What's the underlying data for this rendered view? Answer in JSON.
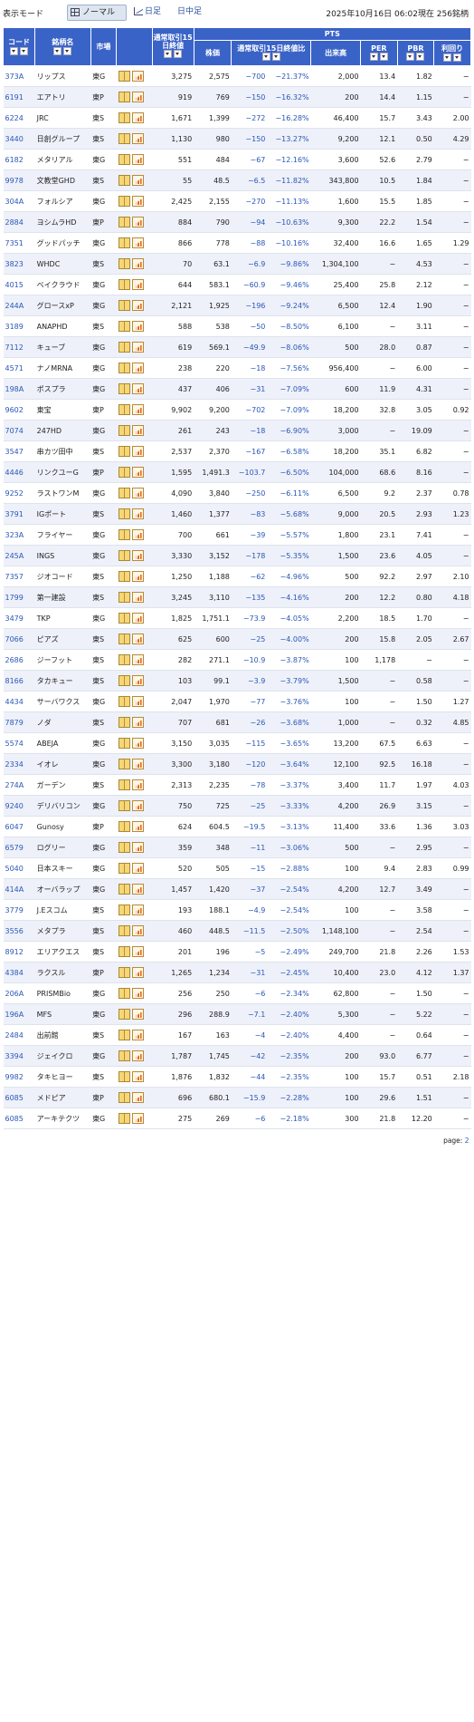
{
  "toolbar": {
    "mode_label": "表示モード",
    "normal": "ノーマル",
    "daily": "日足",
    "intraday": "日中足",
    "timestamp": "2025年10月16日  06:02現在  256銘柄"
  },
  "headers": {
    "code": "コード",
    "name": "銘柄名",
    "market": "市場",
    "prev_close": "通常取引15日終値",
    "pts": "PTS",
    "price": "株価",
    "change": "通常取引15日終値比",
    "volume": "出来高",
    "per": "PER",
    "pbr": "PBR",
    "yield": "利回り"
  },
  "rows": [
    [
      "373A",
      "リップス",
      "東G",
      "3,275",
      "2,575",
      "−700",
      "−21.37%",
      "2,000",
      "13.4",
      "1.82",
      "−"
    ],
    [
      "6191",
      "エアトリ",
      "東P",
      "919",
      "769",
      "−150",
      "−16.32%",
      "200",
      "14.4",
      "1.15",
      "−"
    ],
    [
      "6224",
      "JRC",
      "東S",
      "1,671",
      "1,399",
      "−272",
      "−16.28%",
      "46,400",
      "15.7",
      "3.43",
      "2.00"
    ],
    [
      "3440",
      "日創グループ",
      "東S",
      "1,130",
      "980",
      "−150",
      "−13.27%",
      "9,200",
      "12.1",
      "0.50",
      "4.29"
    ],
    [
      "6182",
      "メタリアル",
      "東G",
      "551",
      "484",
      "−67",
      "−12.16%",
      "3,600",
      "52.6",
      "2.79",
      "−"
    ],
    [
      "9978",
      "文教堂GHD",
      "東S",
      "55",
      "48.5",
      "−6.5",
      "−11.82%",
      "343,800",
      "10.5",
      "1.84",
      "−"
    ],
    [
      "304A",
      "フォルシア",
      "東G",
      "2,425",
      "2,155",
      "−270",
      "−11.13%",
      "1,600",
      "15.5",
      "1.85",
      "−"
    ],
    [
      "2884",
      "ヨシムラHD",
      "東P",
      "884",
      "790",
      "−94",
      "−10.63%",
      "9,300",
      "22.2",
      "1.54",
      "−"
    ],
    [
      "7351",
      "グッドパッチ",
      "東G",
      "866",
      "778",
      "−88",
      "−10.16%",
      "32,400",
      "16.6",
      "1.65",
      "1.29"
    ],
    [
      "3823",
      "WHDC",
      "東S",
      "70",
      "63.1",
      "−6.9",
      "−9.86%",
      "1,304,100",
      "−",
      "4.53",
      "−"
    ],
    [
      "4015",
      "ベイクラウド",
      "東G",
      "644",
      "583.1",
      "−60.9",
      "−9.46%",
      "25,400",
      "25.8",
      "2.12",
      "−"
    ],
    [
      "244A",
      "グロースxP",
      "東G",
      "2,121",
      "1,925",
      "−196",
      "−9.24%",
      "6,500",
      "12.4",
      "1.90",
      "−"
    ],
    [
      "3189",
      "ANAPHD",
      "東S",
      "588",
      "538",
      "−50",
      "−8.50%",
      "6,100",
      "−",
      "3.11",
      "−"
    ],
    [
      "7112",
      "キューブ",
      "東G",
      "619",
      "569.1",
      "−49.9",
      "−8.06%",
      "500",
      "28.0",
      "0.87",
      "−"
    ],
    [
      "4571",
      "ナノMRNA",
      "東G",
      "238",
      "220",
      "−18",
      "−7.56%",
      "956,400",
      "−",
      "6.00",
      "−"
    ],
    [
      "198A",
      "ポスプラ",
      "東G",
      "437",
      "406",
      "−31",
      "−7.09%",
      "600",
      "11.9",
      "4.31",
      "−"
    ],
    [
      "9602",
      "東宝",
      "東P",
      "9,902",
      "9,200",
      "−702",
      "−7.09%",
      "18,200",
      "32.8",
      "3.05",
      "0.92"
    ],
    [
      "7074",
      "247HD",
      "東G",
      "261",
      "243",
      "−18",
      "−6.90%",
      "3,000",
      "−",
      "19.09",
      "−"
    ],
    [
      "3547",
      "串カツ田中",
      "東S",
      "2,537",
      "2,370",
      "−167",
      "−6.58%",
      "18,200",
      "35.1",
      "6.82",
      "−"
    ],
    [
      "4446",
      "リンクユーG",
      "東P",
      "1,595",
      "1,491.3",
      "−103.7",
      "−6.50%",
      "104,000",
      "68.6",
      "8.16",
      "−"
    ],
    [
      "9252",
      "ラストワンM",
      "東G",
      "4,090",
      "3,840",
      "−250",
      "−6.11%",
      "6,500",
      "9.2",
      "2.37",
      "0.78"
    ],
    [
      "3791",
      "IGポート",
      "東S",
      "1,460",
      "1,377",
      "−83",
      "−5.68%",
      "9,000",
      "20.5",
      "2.93",
      "1.23"
    ],
    [
      "323A",
      "フライヤー",
      "東G",
      "700",
      "661",
      "−39",
      "−5.57%",
      "1,800",
      "23.1",
      "7.41",
      "−"
    ],
    [
      "245A",
      "INGS",
      "東G",
      "3,330",
      "3,152",
      "−178",
      "−5.35%",
      "1,500",
      "23.6",
      "4.05",
      "−"
    ],
    [
      "7357",
      "ジオコード",
      "東S",
      "1,250",
      "1,188",
      "−62",
      "−4.96%",
      "500",
      "92.2",
      "2.97",
      "2.10"
    ],
    [
      "1799",
      "第一建設",
      "東S",
      "3,245",
      "3,110",
      "−135",
      "−4.16%",
      "200",
      "12.2",
      "0.80",
      "4.18"
    ],
    [
      "3479",
      "TKP",
      "東G",
      "1,825",
      "1,751.1",
      "−73.9",
      "−4.05%",
      "2,200",
      "18.5",
      "1.70",
      "−"
    ],
    [
      "7066",
      "ピアズ",
      "東S",
      "625",
      "600",
      "−25",
      "−4.00%",
      "200",
      "15.8",
      "2.05",
      "2.67"
    ],
    [
      "2686",
      "ジーフット",
      "東S",
      "282",
      "271.1",
      "−10.9",
      "−3.87%",
      "100",
      "1,178",
      "−",
      "−"
    ],
    [
      "8166",
      "タカキュー",
      "東S",
      "103",
      "99.1",
      "−3.9",
      "−3.79%",
      "1,500",
      "−",
      "0.58",
      "−"
    ],
    [
      "4434",
      "サーバワクス",
      "東G",
      "2,047",
      "1,970",
      "−77",
      "−3.76%",
      "100",
      "−",
      "1.50",
      "1.27"
    ],
    [
      "7879",
      "ノダ",
      "東S",
      "707",
      "681",
      "−26",
      "−3.68%",
      "1,000",
      "−",
      "0.32",
      "4.85"
    ],
    [
      "5574",
      "ABEJA",
      "東G",
      "3,150",
      "3,035",
      "−115",
      "−3.65%",
      "13,200",
      "67.5",
      "6.63",
      "−"
    ],
    [
      "2334",
      "イオレ",
      "東G",
      "3,300",
      "3,180",
      "−120",
      "−3.64%",
      "12,100",
      "92.5",
      "16.18",
      "−"
    ],
    [
      "274A",
      "ガーデン",
      "東S",
      "2,313",
      "2,235",
      "−78",
      "−3.37%",
      "3,400",
      "11.7",
      "1.97",
      "4.03"
    ],
    [
      "9240",
      "デリバリコン",
      "東G",
      "750",
      "725",
      "−25",
      "−3.33%",
      "4,200",
      "26.9",
      "3.15",
      "−"
    ],
    [
      "6047",
      "Gunosy",
      "東P",
      "624",
      "604.5",
      "−19.5",
      "−3.13%",
      "11,400",
      "33.6",
      "1.36",
      "3.03"
    ],
    [
      "6579",
      "ログリー",
      "東G",
      "359",
      "348",
      "−11",
      "−3.06%",
      "500",
      "−",
      "2.95",
      "−"
    ],
    [
      "5040",
      "日本スキー",
      "東G",
      "520",
      "505",
      "−15",
      "−2.88%",
      "100",
      "9.4",
      "2.83",
      "0.99"
    ],
    [
      "414A",
      "オーバラップ",
      "東G",
      "1,457",
      "1,420",
      "−37",
      "−2.54%",
      "4,200",
      "12.7",
      "3.49",
      "−"
    ],
    [
      "3779",
      "J.Eスコム",
      "東S",
      "193",
      "188.1",
      "−4.9",
      "−2.54%",
      "100",
      "−",
      "3.58",
      "−"
    ],
    [
      "3556",
      "メタプラ",
      "東S",
      "460",
      "448.5",
      "−11.5",
      "−2.50%",
      "1,148,100",
      "−",
      "2.54",
      "−"
    ],
    [
      "8912",
      "エリアクエス",
      "東S",
      "201",
      "196",
      "−5",
      "−2.49%",
      "249,700",
      "21.8",
      "2.26",
      "1.53"
    ],
    [
      "4384",
      "ラクスル",
      "東P",
      "1,265",
      "1,234",
      "−31",
      "−2.45%",
      "10,400",
      "23.0",
      "4.12",
      "1.37"
    ],
    [
      "206A",
      "PRISMBio",
      "東G",
      "256",
      "250",
      "−6",
      "−2.34%",
      "62,800",
      "−",
      "1.50",
      "−"
    ],
    [
      "196A",
      "MFS",
      "東G",
      "296",
      "288.9",
      "−7.1",
      "−2.40%",
      "5,300",
      "−",
      "5.22",
      "−"
    ],
    [
      "2484",
      "出前館",
      "東S",
      "167",
      "163",
      "−4",
      "−2.40%",
      "4,400",
      "−",
      "0.64",
      "−"
    ],
    [
      "3394",
      "ジェイクロ",
      "東G",
      "1,787",
      "1,745",
      "−42",
      "−2.35%",
      "200",
      "93.0",
      "6.77",
      "−"
    ],
    [
      "9982",
      "タキヒヨー",
      "東S",
      "1,876",
      "1,832",
      "−44",
      "−2.35%",
      "100",
      "15.7",
      "0.51",
      "2.18"
    ],
    [
      "6085",
      "メドピア",
      "東P",
      "696",
      "680.1",
      "−15.9",
      "−2.28%",
      "100",
      "29.6",
      "1.51",
      "−"
    ],
    [
      "6085",
      "アーキテクツ",
      "東G",
      "275",
      "269",
      "−6",
      "−2.18%",
      "300",
      "21.8",
      "12.20",
      "−"
    ]
  ],
  "pagination": {
    "prefix": "page: ",
    "link": "2"
  }
}
